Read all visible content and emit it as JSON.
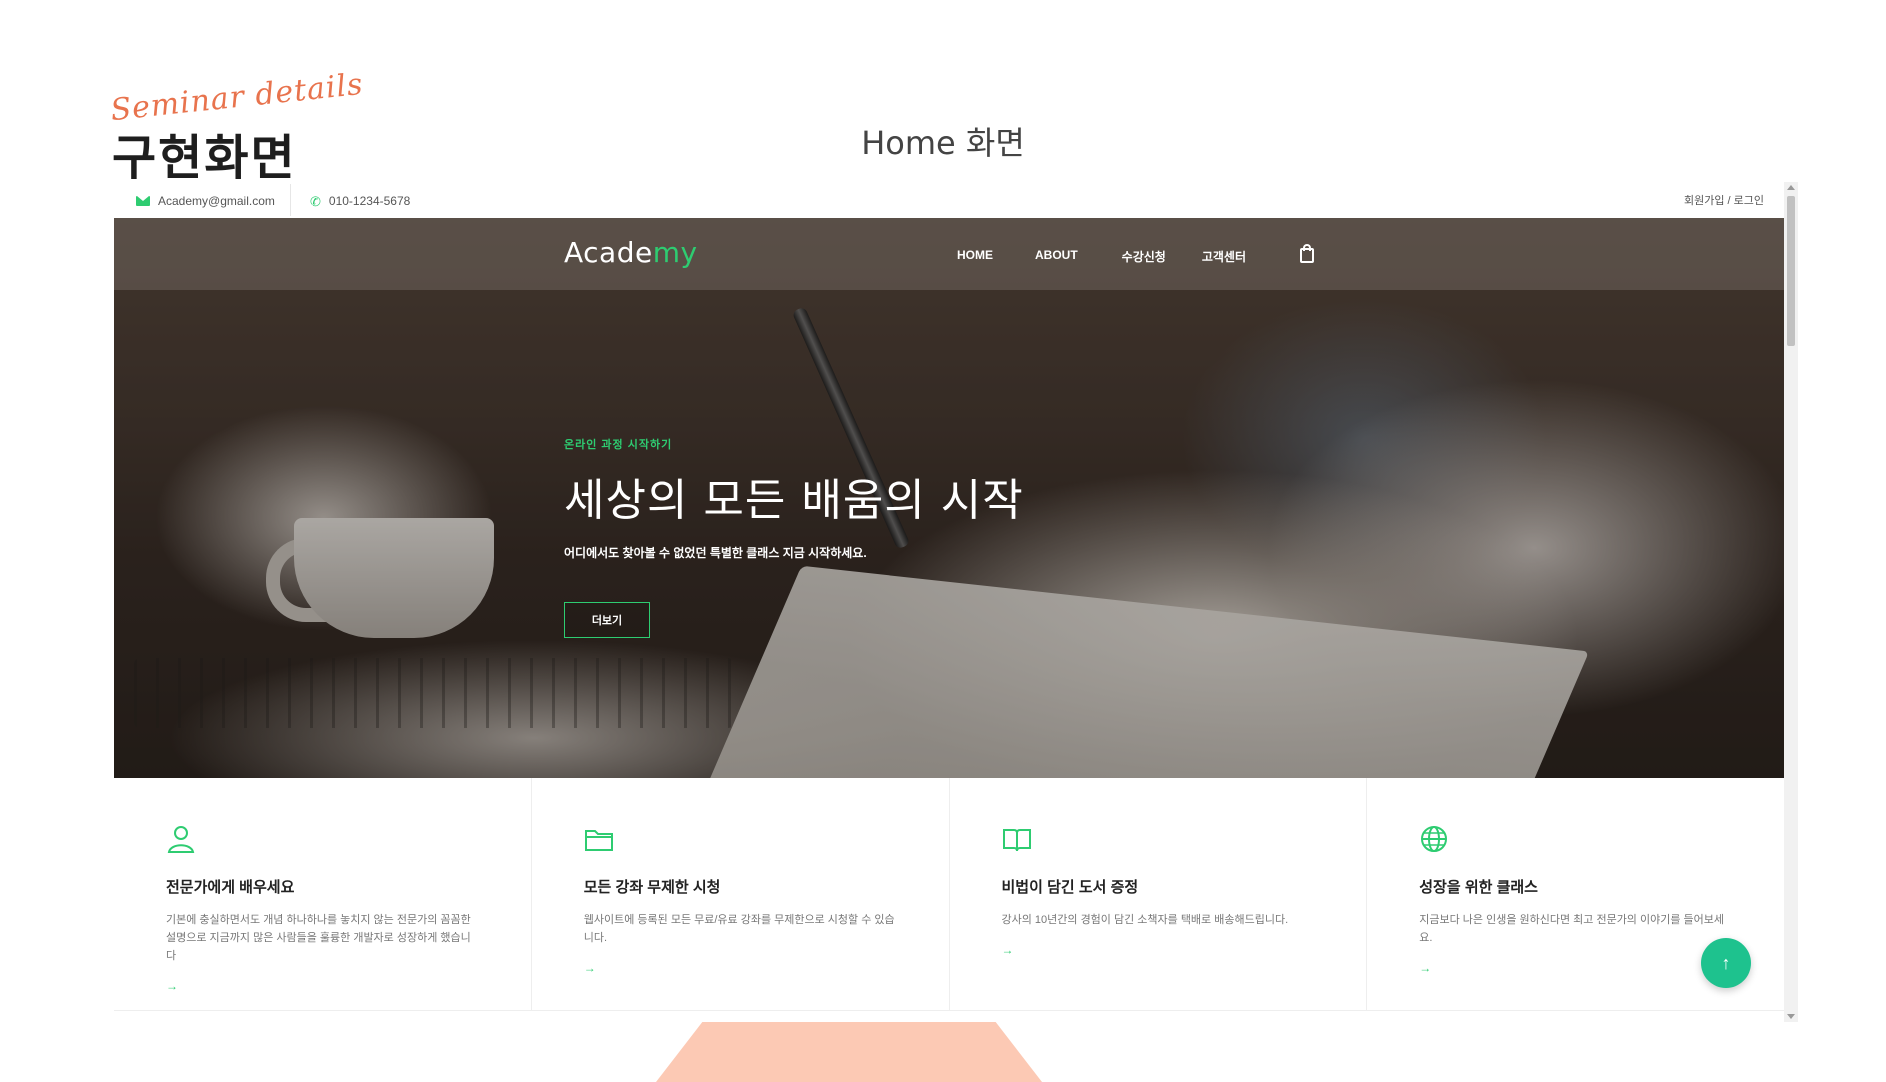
{
  "slide": {
    "tag": "Seminar details",
    "title": "구현화면",
    "page_label": "Home 화면"
  },
  "topbar": {
    "email": "Academy@gmail.com",
    "phone": "010-1234-5678",
    "auth": "회원가입 / 로그인"
  },
  "nav": {
    "logo_main": "Acade",
    "logo_accent": "my",
    "items": [
      "HOME",
      "ABOUT",
      "수강신청",
      "고객센터"
    ],
    "cart_icon": "shopping-bag-icon"
  },
  "hero": {
    "eyebrow": "온라인 과정 시작하기",
    "title": "세상의 모든 배움의 시작",
    "subtitle": "어디에서도 찾아볼 수 없었던 특별한 클래스 지금 시작하세요.",
    "button": "더보기"
  },
  "features": [
    {
      "icon": "user-icon",
      "title": "전문가에게 배우세요",
      "desc": "기본에 충실하면서도 개념 하나하나를 놓치지 않는 전문가의 꼼꼼한 설명으로 지금까지 많은 사람들을 훌륭한 개발자로 성장하게 했습니다",
      "arrow": "→"
    },
    {
      "icon": "folder-icon",
      "title": "모든 강좌 무제한 시청",
      "desc": "웹사이트에 등록된 모든 무료/유료 강좌를 무제한으로 시청할 수 있습니다.",
      "arrow": "→"
    },
    {
      "icon": "book-icon",
      "title": "비법이 담긴 도서 증정",
      "desc": "강사의 10년간의 경험이 담긴 소책자를 택배로 배송해드립니다.",
      "arrow": "→"
    },
    {
      "icon": "globe-icon",
      "title": "성장을 위한 클래스",
      "desc": "지금보다 나은 인생을 원하신다면 최고 전문가의 이야기를 들어보세요.",
      "arrow": "→"
    }
  ],
  "to_top": "↑",
  "colors": {
    "accent": "#2ecc71",
    "to_top": "#1ec28e",
    "slide_tag": "#e8734d",
    "deco": "#fcc9b4"
  }
}
